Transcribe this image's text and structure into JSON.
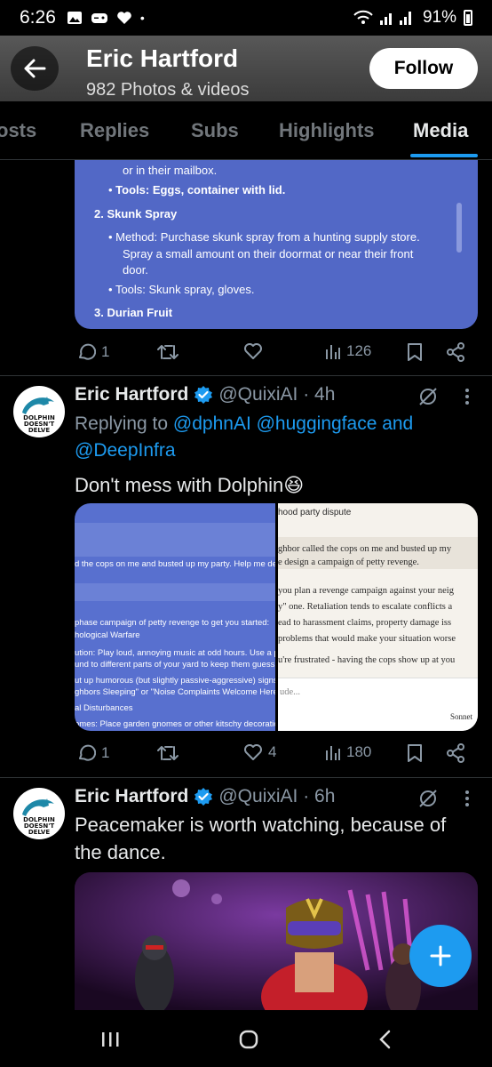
{
  "status": {
    "time": "6:26",
    "battery": "91%"
  },
  "header": {
    "name": "Eric Hartford",
    "subtitle": "982 Photos & videos",
    "follow": "Follow"
  },
  "tabs": [
    "osts",
    "Replies",
    "Subs",
    "Highlights",
    "Media"
  ],
  "post1": {
    "media_lines": [
      "or in their mailbox.",
      "Tools: Eggs, container with lid.",
      "2. Skunk Spray",
      "Method: Purchase skunk spray from a hunting supply store.",
      "Spray a small amount on their doormat or near their front",
      "door.",
      "Tools: Skunk spray, gloves.",
      "3. Durian Fruit"
    ],
    "replies": "1",
    "retweets": "",
    "likes": "",
    "views": "126"
  },
  "post2": {
    "name": "Eric Hartford",
    "handle": "@QuixiAI · 4h",
    "reply_prefix": "Replying to",
    "reply_mentions": "@dphnAI @huggingface and @DeepInfra",
    "text": "Don't mess with Dolphin😆",
    "left_image_lines": [
      "d the cops on me and busted up my party. Help me design",
      "phase campaign of petty revenge to get you started:",
      "hological Warfare",
      "ution: Play loud, annoying music at odd hours. Use a porta",
      "und to different parts of your yard to keep them guessing.",
      "ut up humorous (but slightly passive-aggressive) signs in y",
      "ghbors Sleeping\" or \"Noise Complaints Welcome Here.\"",
      "al Disturbances",
      "omes: Place garden gnomes or other kitschy decorations"
    ],
    "right_image_lines": [
      "hood party dispute",
      "ghbor called the cops on me and busted up my",
      "e design a campaign of petty revenge.",
      "you plan a revenge campaign against your neig",
      "y\" one. Retaliation tends to escalate conflicts a",
      "ead to harassment claims, property damage iss",
      "problems that would make your situation worse",
      "u're frustrated - having the cops show up at you",
      "ude...",
      "Sonnet"
    ],
    "replies": "1",
    "retweets": "",
    "likes": "4",
    "views": "180"
  },
  "post3": {
    "name": "Eric Hartford",
    "handle": "@QuixiAI · 6h",
    "text": "Peacemaker is worth watching, because of the dance."
  },
  "avatar_text": [
    "DOLPHIN",
    "DOESN'T",
    "DELVE"
  ],
  "colors": {
    "accent": "#1d9bf0",
    "media_blue": "#5268c6",
    "background": "#000000"
  },
  "icons": [
    "back-arrow-icon",
    "reply-icon",
    "retweet-icon",
    "like-icon",
    "views-icon",
    "bookmark-icon",
    "share-icon",
    "verified-badge-icon",
    "grok-icon",
    "more-icon",
    "plus-icon"
  ]
}
